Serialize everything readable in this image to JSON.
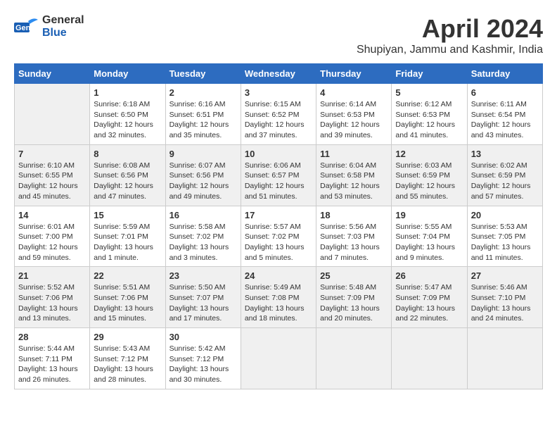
{
  "header": {
    "logo_line1": "General",
    "logo_line2": "Blue",
    "month": "April 2024",
    "location": "Shupiyan, Jammu and Kashmir, India"
  },
  "days_of_week": [
    "Sunday",
    "Monday",
    "Tuesday",
    "Wednesday",
    "Thursday",
    "Friday",
    "Saturday"
  ],
  "weeks": [
    [
      {
        "num": "",
        "details": ""
      },
      {
        "num": "1",
        "details": "Sunrise: 6:18 AM\nSunset: 6:50 PM\nDaylight: 12 hours\nand 32 minutes."
      },
      {
        "num": "2",
        "details": "Sunrise: 6:16 AM\nSunset: 6:51 PM\nDaylight: 12 hours\nand 35 minutes."
      },
      {
        "num": "3",
        "details": "Sunrise: 6:15 AM\nSunset: 6:52 PM\nDaylight: 12 hours\nand 37 minutes."
      },
      {
        "num": "4",
        "details": "Sunrise: 6:14 AM\nSunset: 6:53 PM\nDaylight: 12 hours\nand 39 minutes."
      },
      {
        "num": "5",
        "details": "Sunrise: 6:12 AM\nSunset: 6:53 PM\nDaylight: 12 hours\nand 41 minutes."
      },
      {
        "num": "6",
        "details": "Sunrise: 6:11 AM\nSunset: 6:54 PM\nDaylight: 12 hours\nand 43 minutes."
      }
    ],
    [
      {
        "num": "7",
        "details": "Sunrise: 6:10 AM\nSunset: 6:55 PM\nDaylight: 12 hours\nand 45 minutes."
      },
      {
        "num": "8",
        "details": "Sunrise: 6:08 AM\nSunset: 6:56 PM\nDaylight: 12 hours\nand 47 minutes."
      },
      {
        "num": "9",
        "details": "Sunrise: 6:07 AM\nSunset: 6:56 PM\nDaylight: 12 hours\nand 49 minutes."
      },
      {
        "num": "10",
        "details": "Sunrise: 6:06 AM\nSunset: 6:57 PM\nDaylight: 12 hours\nand 51 minutes."
      },
      {
        "num": "11",
        "details": "Sunrise: 6:04 AM\nSunset: 6:58 PM\nDaylight: 12 hours\nand 53 minutes."
      },
      {
        "num": "12",
        "details": "Sunrise: 6:03 AM\nSunset: 6:59 PM\nDaylight: 12 hours\nand 55 minutes."
      },
      {
        "num": "13",
        "details": "Sunrise: 6:02 AM\nSunset: 6:59 PM\nDaylight: 12 hours\nand 57 minutes."
      }
    ],
    [
      {
        "num": "14",
        "details": "Sunrise: 6:01 AM\nSunset: 7:00 PM\nDaylight: 12 hours\nand 59 minutes."
      },
      {
        "num": "15",
        "details": "Sunrise: 5:59 AM\nSunset: 7:01 PM\nDaylight: 13 hours\nand 1 minute."
      },
      {
        "num": "16",
        "details": "Sunrise: 5:58 AM\nSunset: 7:02 PM\nDaylight: 13 hours\nand 3 minutes."
      },
      {
        "num": "17",
        "details": "Sunrise: 5:57 AM\nSunset: 7:02 PM\nDaylight: 13 hours\nand 5 minutes."
      },
      {
        "num": "18",
        "details": "Sunrise: 5:56 AM\nSunset: 7:03 PM\nDaylight: 13 hours\nand 7 minutes."
      },
      {
        "num": "19",
        "details": "Sunrise: 5:55 AM\nSunset: 7:04 PM\nDaylight: 13 hours\nand 9 minutes."
      },
      {
        "num": "20",
        "details": "Sunrise: 5:53 AM\nSunset: 7:05 PM\nDaylight: 13 hours\nand 11 minutes."
      }
    ],
    [
      {
        "num": "21",
        "details": "Sunrise: 5:52 AM\nSunset: 7:06 PM\nDaylight: 13 hours\nand 13 minutes."
      },
      {
        "num": "22",
        "details": "Sunrise: 5:51 AM\nSunset: 7:06 PM\nDaylight: 13 hours\nand 15 minutes."
      },
      {
        "num": "23",
        "details": "Sunrise: 5:50 AM\nSunset: 7:07 PM\nDaylight: 13 hours\nand 17 minutes."
      },
      {
        "num": "24",
        "details": "Sunrise: 5:49 AM\nSunset: 7:08 PM\nDaylight: 13 hours\nand 18 minutes."
      },
      {
        "num": "25",
        "details": "Sunrise: 5:48 AM\nSunset: 7:09 PM\nDaylight: 13 hours\nand 20 minutes."
      },
      {
        "num": "26",
        "details": "Sunrise: 5:47 AM\nSunset: 7:09 PM\nDaylight: 13 hours\nand 22 minutes."
      },
      {
        "num": "27",
        "details": "Sunrise: 5:46 AM\nSunset: 7:10 PM\nDaylight: 13 hours\nand 24 minutes."
      }
    ],
    [
      {
        "num": "28",
        "details": "Sunrise: 5:44 AM\nSunset: 7:11 PM\nDaylight: 13 hours\nand 26 minutes."
      },
      {
        "num": "29",
        "details": "Sunrise: 5:43 AM\nSunset: 7:12 PM\nDaylight: 13 hours\nand 28 minutes."
      },
      {
        "num": "30",
        "details": "Sunrise: 5:42 AM\nSunset: 7:12 PM\nDaylight: 13 hours\nand 30 minutes."
      },
      {
        "num": "",
        "details": ""
      },
      {
        "num": "",
        "details": ""
      },
      {
        "num": "",
        "details": ""
      },
      {
        "num": "",
        "details": ""
      }
    ]
  ]
}
